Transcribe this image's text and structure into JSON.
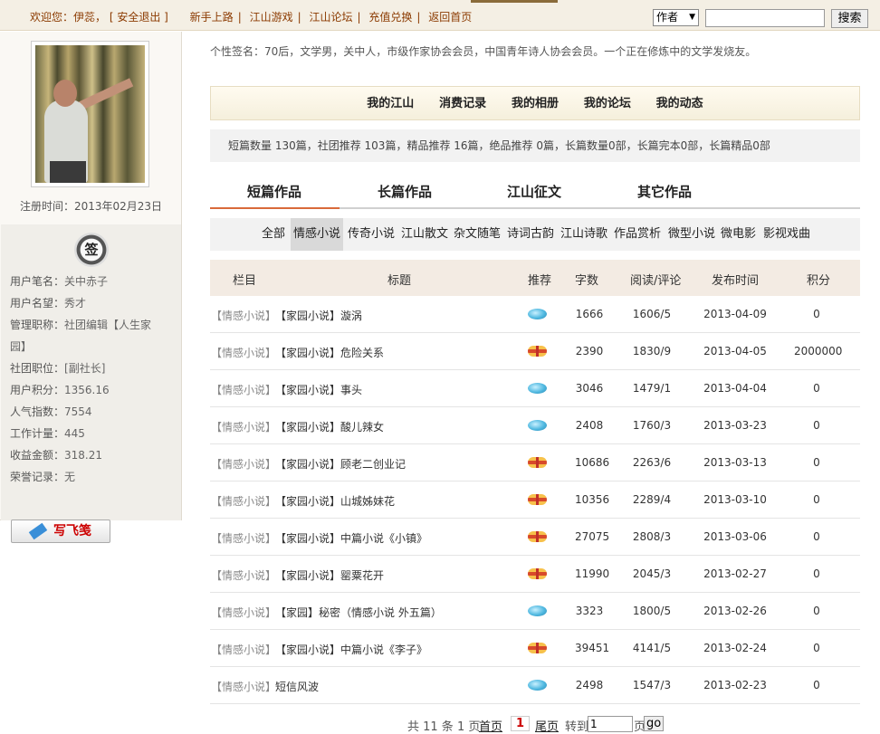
{
  "topbar": {
    "welcome": "欢迎您：伊蕊，",
    "logout": "[ 安全退出 ]",
    "links": [
      "新手上路",
      "江山游戏",
      "江山论坛",
      "充值兑换",
      "返回首页"
    ],
    "search_select": "作者",
    "search_button": "搜索"
  },
  "sidebar": {
    "reg_time": "注册时间：2013年02月23日",
    "sign_badge": "签",
    "fields": [
      {
        "label": "用户笔名：",
        "value": "关中赤子"
      },
      {
        "label": "用户名望：",
        "value": "秀才"
      },
      {
        "label": "管理职称：",
        "value": "社团编辑【人生家"
      },
      {
        "label": "",
        "value": "园】"
      },
      {
        "label": "社团职位：",
        "value": "[副社长]"
      },
      {
        "label": "用户积分：",
        "value": "1356.16"
      },
      {
        "label": "人气指数：",
        "value": "7554"
      },
      {
        "label": "工作计量：",
        "value": "445"
      },
      {
        "label": "收益金额：",
        "value": "318.21"
      },
      {
        "label": "荣誉记录：",
        "value": "无"
      }
    ],
    "write_button": "写飞笺"
  },
  "signature": "个性签名：70后，文学男，关中人，市级作家协会会员，中国青年诗人协会会员。一个正在修炼中的文学发烧友。",
  "menu": [
    "我的江山",
    "消费记录",
    "我的相册",
    "我的论坛",
    "我的动态"
  ],
  "stats": "短篇数量 130篇，社团推荐 103篇，精品推荐 16篇，绝品推荐 0篇，长篇数量0部，长篇完本0部，长篇精品0部",
  "tabs": [
    "短篇作品",
    "长篇作品",
    "江山征文",
    "其它作品"
  ],
  "categories": [
    "全部",
    "情感小说",
    "传奇小说",
    "江山散文",
    "杂文随笔",
    "诗词古韵",
    "江山诗歌",
    "作品赏析",
    "微型小说",
    "微电影",
    "影视戏曲"
  ],
  "table": {
    "headers": [
      "栏目",
      "标题",
      "推荐",
      "字数",
      "阅读/评论",
      "发布时间",
      "积分"
    ],
    "rows": [
      {
        "cat": "【情感小说】",
        "title": "【家园小说】漩涡",
        "rec": "blue",
        "words": "1666",
        "reads": "1606/5",
        "date": "2013-04-09",
        "score": "0"
      },
      {
        "cat": "【情感小说】",
        "title": "【家园小说】危险关系",
        "rec": "red",
        "words": "2390",
        "reads": "1830/9",
        "date": "2013-04-05",
        "score": "2000000"
      },
      {
        "cat": "【情感小说】",
        "title": "【家园小说】事头",
        "rec": "blue",
        "words": "3046",
        "reads": "1479/1",
        "date": "2013-04-04",
        "score": "0"
      },
      {
        "cat": "【情感小说】",
        "title": "【家园小说】酸儿辣女",
        "rec": "blue",
        "words": "2408",
        "reads": "1760/3",
        "date": "2013-03-23",
        "score": "0"
      },
      {
        "cat": "【情感小说】",
        "title": "【家园小说】顾老二创业记",
        "rec": "red",
        "words": "10686",
        "reads": "2263/6",
        "date": "2013-03-13",
        "score": "0"
      },
      {
        "cat": "【情感小说】",
        "title": "【家园小说】山城姊妹花",
        "rec": "red",
        "words": "10356",
        "reads": "2289/4",
        "date": "2013-03-10",
        "score": "0"
      },
      {
        "cat": "【情感小说】",
        "title": "【家园小说】中篇小说《小镇》",
        "rec": "red",
        "words": "27075",
        "reads": "2808/3",
        "date": "2013-03-06",
        "score": "0"
      },
      {
        "cat": "【情感小说】",
        "title": "【家园小说】罂粟花开",
        "rec": "red",
        "words": "11990",
        "reads": "2045/3",
        "date": "2013-02-27",
        "score": "0"
      },
      {
        "cat": "【情感小说】",
        "title": "【家园】秘密（情感小说 外五篇）",
        "rec": "blue",
        "words": "3323",
        "reads": "1800/5",
        "date": "2013-02-26",
        "score": "0"
      },
      {
        "cat": "【情感小说】",
        "title": "【家园小说】中篇小说《李子》",
        "rec": "red",
        "words": "39451",
        "reads": "4141/5",
        "date": "2013-02-24",
        "score": "0"
      },
      {
        "cat": "【情感小说】",
        "title": "短信风波",
        "rec": "blue",
        "words": "2498",
        "reads": "1547/3",
        "date": "2013-02-23",
        "score": "0"
      }
    ]
  },
  "pager": {
    "summary": "共 11 条 1 页",
    "first": "首页",
    "current": "1",
    "last": "尾页",
    "goto_label": "转到",
    "goto_value": "1",
    "page_suffix": "页",
    "go": "go"
  }
}
